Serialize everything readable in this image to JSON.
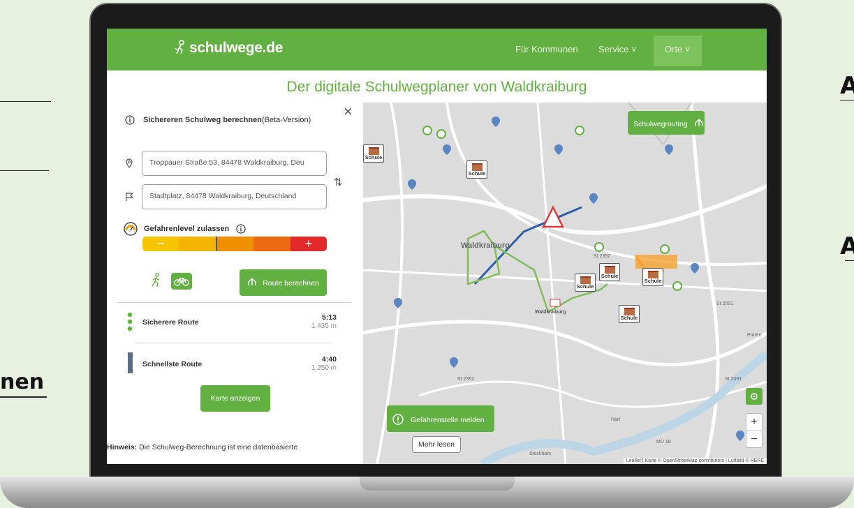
{
  "page": {
    "left_fragment_text": "nen",
    "right_fragment_letters": [
      "A",
      "A"
    ]
  },
  "nav": {
    "logo": "schulwege.de",
    "items": [
      "Für Kommunen",
      "Service ˅",
      "Orte ˅"
    ]
  },
  "subtitle": "Der digitale Schulwegplaner von Waldkraiburg",
  "panel": {
    "heading_bold": "Sichereren Schulweg berechnen",
    "heading_suffix": " (Beta-Version)",
    "close_symbol": "×",
    "start_value": "Troppauer Straße 53, 84478 Waldkraiburg, Deu",
    "destination_value": "Stadtplatz, 84478 Waldkraiburg, Deutschland",
    "swap_symbol": "⇅",
    "danger_label": "Gefahrenlevel zulassen",
    "danger_minus": "−",
    "danger_plus": "+",
    "danger_level_fraction": 0.4,
    "route_button": "Route berechnen",
    "routes": [
      {
        "name": "Sicherere Route",
        "time": "5:13",
        "distance": "1.435 m"
      },
      {
        "name": "Schnellste Route",
        "time": "4:40",
        "distance": "1.250 m"
      }
    ],
    "map_button": "Karte anzeigen",
    "hint_bold": "Hinweis:",
    "hint_text": " Die Schulweg-Berechnung ist eine datenbasierte"
  },
  "map": {
    "routing_button": "Schulwegrouting",
    "report_button": "Gefahrenstelle melden",
    "more_button": "Mehr lesen",
    "city_label": "Waldkraiburg",
    "station_label": "Waldkraiburg",
    "school_label": "Schule",
    "zoom_in": "+",
    "zoom_out": "−",
    "attribution": "Leaflet | Karte © OpenStreetMap contributors | Luftbild © HERE",
    "street_labels": [
      "St 2352",
      "St 2352",
      "St 2091",
      "MÜ 18",
      "Stockham",
      "Hart",
      "Pürten",
      "St 2091"
    ]
  },
  "colors": {
    "brand_green": "#63b042",
    "danger_scale": [
      "#e33",
      "#f07a10",
      "#f5a000",
      "#f6c400"
    ]
  }
}
